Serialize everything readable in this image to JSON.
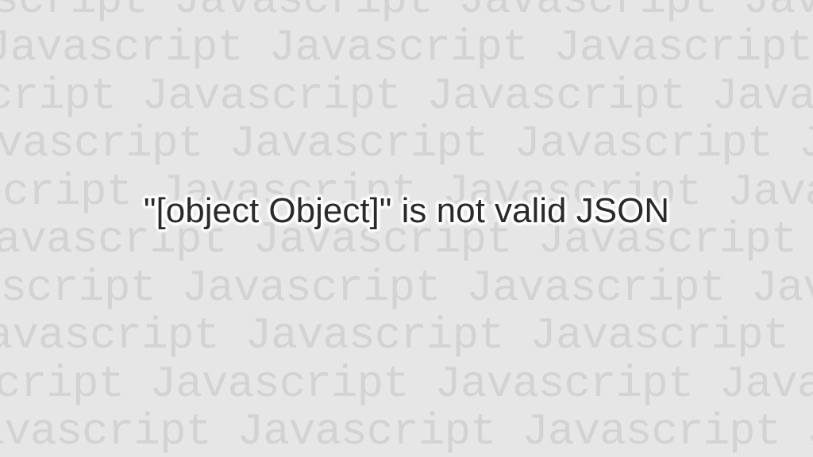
{
  "background": {
    "repeated_word": "Javascript",
    "row_text": "Javascript Javascript Javascript Javascript Javascript"
  },
  "main": {
    "message": "\"[object Object]\" is not valid JSON"
  }
}
